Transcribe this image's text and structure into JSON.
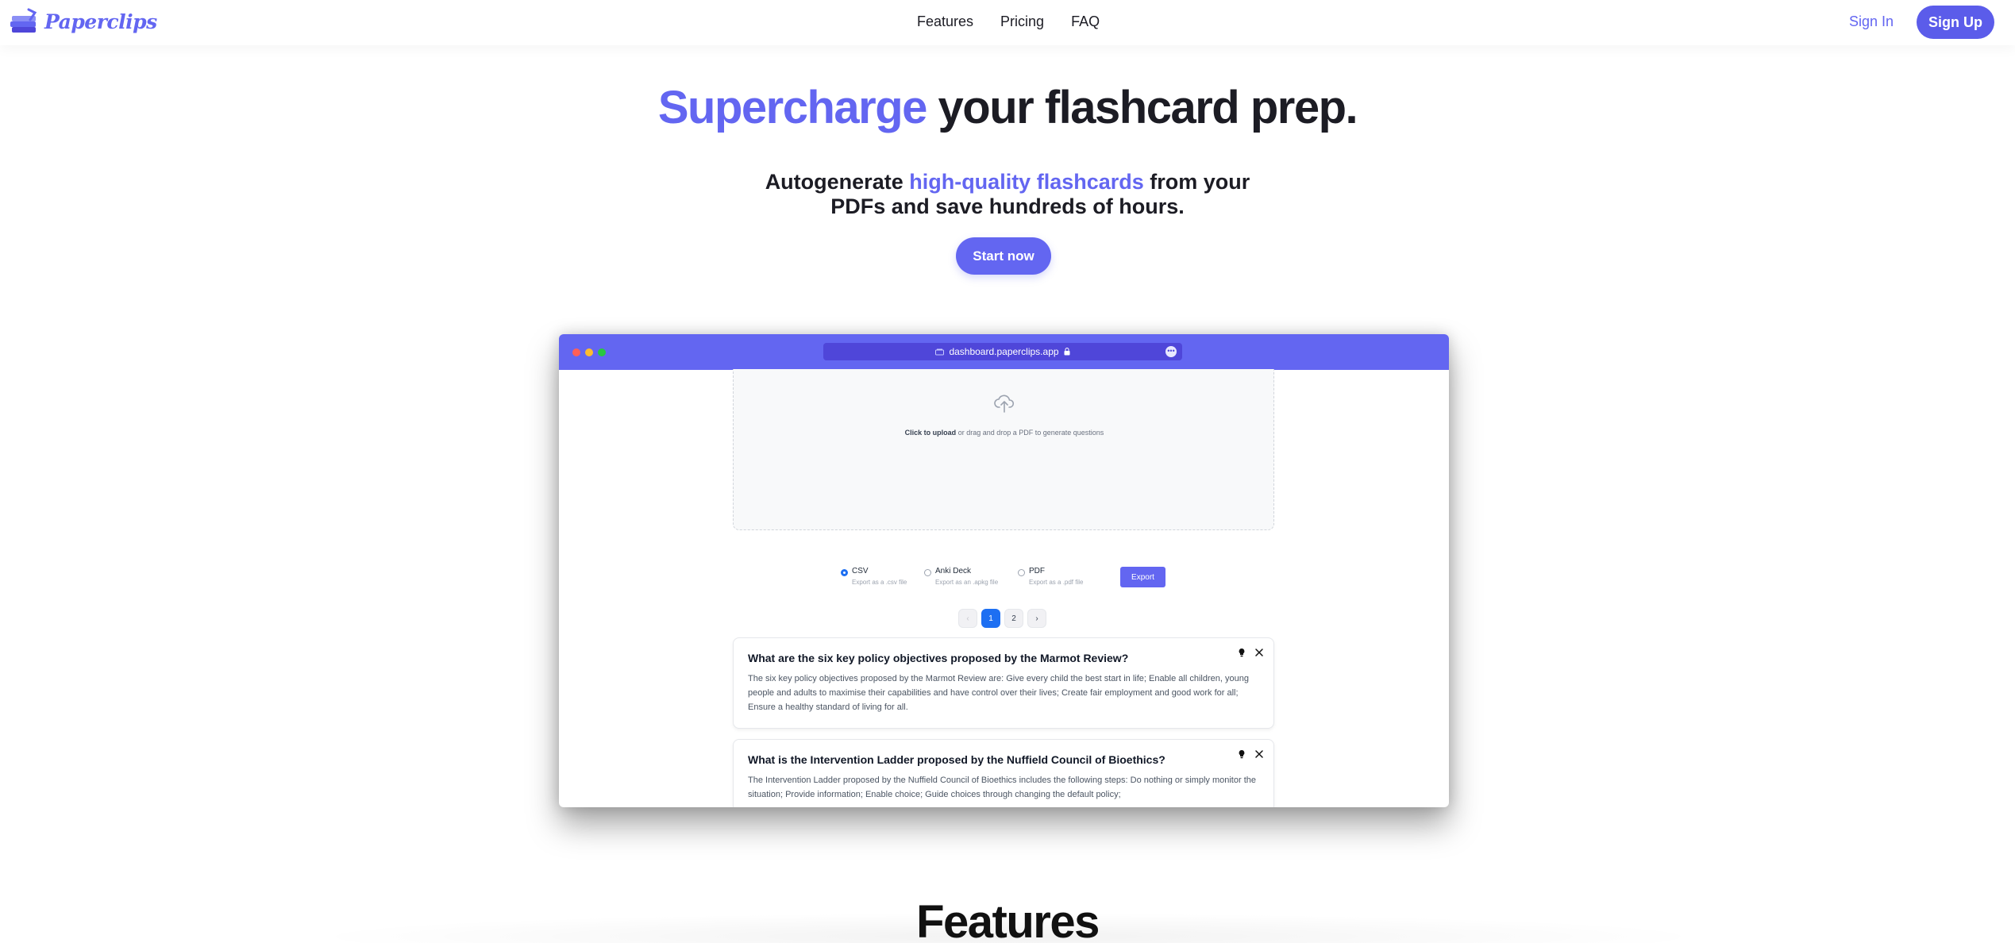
{
  "nav": {
    "brand": "Paperclips",
    "links": [
      "Features",
      "Pricing",
      "FAQ"
    ],
    "sign_in": "Sign In",
    "sign_up": "Sign Up"
  },
  "hero": {
    "title_accent": "Supercharge",
    "title_rest": " your flashcard prep.",
    "subtitle_pre": "Autogenerate ",
    "subtitle_accent": "high-quality flashcards",
    "subtitle_post_line1": " from your",
    "subtitle_line2": "PDFs and save hundreds of hours.",
    "cta": "Start now"
  },
  "browser": {
    "url": "dashboard.paperclips.app",
    "upload": {
      "bold": "Click to upload",
      "rest": " or drag and drop a PDF to generate questions"
    },
    "export_options": [
      {
        "label": "CSV",
        "sub": "Export as a .csv file",
        "selected": true
      },
      {
        "label": "Anki Deck",
        "sub": "Export as an .apkg file",
        "selected": false
      },
      {
        "label": "PDF",
        "sub": "Export as a .pdf file",
        "selected": false
      }
    ],
    "export_button": "Export",
    "pagination": {
      "prev": "‹",
      "pages": [
        "1",
        "2"
      ],
      "current": "1",
      "next": "›"
    },
    "cards": [
      {
        "question": "What are the six key policy objectives proposed by the Marmot Review?",
        "answer": "The six key policy objectives proposed by the Marmot Review are: Give every child the best start in life; Enable all children, young people and adults to maximise their capabilities and have control over their lives; Create fair employment and good work for all; Ensure a healthy standard of living for all."
      },
      {
        "question": "What is the Intervention Ladder proposed by the Nuffield Council of Bioethics?",
        "answer": "The Intervention Ladder proposed by the Nuffield Council of Bioethics includes the following steps: Do nothing or simply monitor the situation; Provide information; Enable choice; Guide choices through changing the default policy;"
      }
    ]
  },
  "features": {
    "title": "Features"
  },
  "colors": {
    "accent": "#6366f1",
    "active_page": "#1d6ff2"
  }
}
